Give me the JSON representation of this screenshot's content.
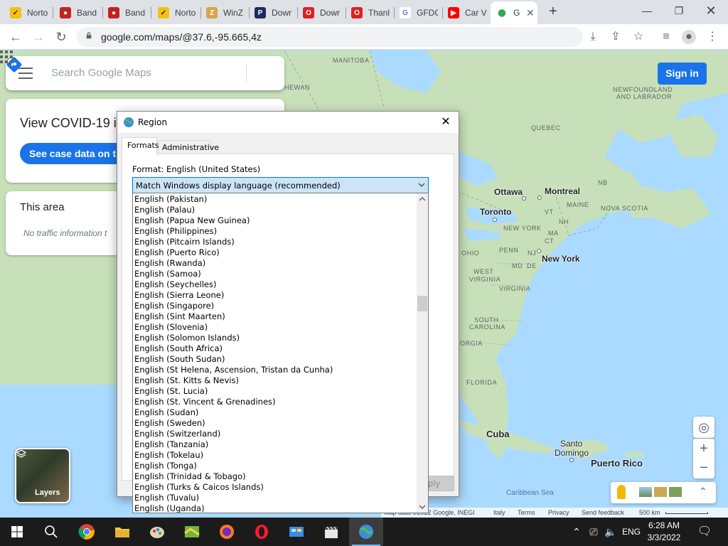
{
  "browser": {
    "tabs": [
      {
        "label": "Norto",
        "color": "#f4c20d",
        "glyph": "✓",
        "fg": "#222"
      },
      {
        "label": "Band",
        "color": "#c5221f",
        "glyph": "●",
        "fg": "#fff"
      },
      {
        "label": "Band",
        "color": "#c5221f",
        "glyph": "●",
        "fg": "#fff"
      },
      {
        "label": "Norto",
        "color": "#f4c20d",
        "glyph": "✓",
        "fg": "#222"
      },
      {
        "label": "WinZ",
        "color": "#d6a64b",
        "glyph": "Z",
        "fg": "#fff"
      },
      {
        "label": "Dowr",
        "color": "#1a2b5c",
        "glyph": "P",
        "fg": "#fff"
      },
      {
        "label": "Dowr",
        "color": "#e0201f",
        "glyph": "O",
        "fg": "#fff"
      },
      {
        "label": "Thanl",
        "color": "#e0201f",
        "glyph": "O",
        "fg": "#fff"
      },
      {
        "label": "GFDC",
        "color": "#ffffff",
        "glyph": "G",
        "fg": "#4285f4"
      },
      {
        "label": "Car V",
        "color": "#ff0000",
        "glyph": "▶",
        "fg": "#fff"
      },
      {
        "label": "G",
        "color": "#ffffff",
        "glyph": "⬤",
        "fg": "#34a853"
      }
    ],
    "url": "google.com/maps/@37.6,-95.665,4z"
  },
  "maps": {
    "search_placeholder": "Search Google Maps",
    "covid_title": "View COVID-19 in",
    "covid_button": "See case data on t",
    "area_title": "This area",
    "area_message": "No traffic information t",
    "sign_in": "Sign in",
    "layers": "Layers",
    "map_labels": {
      "manitoba": "MANITOBA",
      "hewan": "HEWAN",
      "newfoundland": "NEWFOUNDLAND",
      "labrador": "AND LABRADOR",
      "quebec": "QUEBEC",
      "nb": "NB",
      "maine": "MAINE",
      "nova_scotia": "NOVA SCOTIA",
      "vt": "VT",
      "nh": "NH",
      "ma": "MA",
      "ct": "CT",
      "new_york_state": "NEW YORK",
      "ohio": "OHIO",
      "penn": "PENN",
      "nj": "NJ",
      "west": "WEST",
      "virginia_w": "VIRGINIA",
      "md": "MD",
      "de": "DE",
      "virginia": "VIRGINIA",
      "south": "SOUTH",
      "carolina": "CAROLINA",
      "orgia": "ORGIA",
      "florida": "FLORIDA",
      "caribbean": "Caribbean Sea"
    },
    "cities": {
      "ottawa": "Ottawa",
      "montreal": "Montreal",
      "toronto": "Toronto",
      "new_york": "New York",
      "cuba": "Cuba",
      "santo": "Santo",
      "domingo": "Domingo",
      "puerto_rico": "Puerto Rico"
    },
    "footer": {
      "attribution": "Map data ©2022 Google, INEGI",
      "country": "Italy",
      "terms": "Terms",
      "privacy": "Privacy",
      "feedback": "Send feedback",
      "scale": "500 km"
    }
  },
  "dialog": {
    "title": "Region",
    "tabs": [
      "Formats",
      "Administrative"
    ],
    "format_label": "Format: English (United States)",
    "format_selected": "Match Windows display language (recommended)",
    "apply": "Apply",
    "options": [
      "English (Pakistan)",
      "English (Palau)",
      "English (Papua New Guinea)",
      "English (Philippines)",
      "English (Pitcairn Islands)",
      "English (Puerto Rico)",
      "English (Rwanda)",
      "English (Samoa)",
      "English (Seychelles)",
      "English (Sierra Leone)",
      "English (Singapore)",
      "English (Sint Maarten)",
      "English (Slovenia)",
      "English (Solomon Islands)",
      "English (South Africa)",
      "English (South Sudan)",
      "English (St Helena, Ascension, Tristan da Cunha)",
      "English (St. Kitts & Nevis)",
      "English (St. Lucia)",
      "English (St. Vincent & Grenadines)",
      "English (Sudan)",
      "English (Sweden)",
      "English (Switzerland)",
      "English (Tanzania)",
      "English (Tokelau)",
      "English (Tonga)",
      "English (Trinidad & Tobago)",
      "English (Turks & Caicos Islands)",
      "English (Tuvalu)",
      "English (Uganda)"
    ]
  },
  "taskbar": {
    "language": "ENG",
    "time": "6:28 AM",
    "date": "3/3/2022"
  }
}
